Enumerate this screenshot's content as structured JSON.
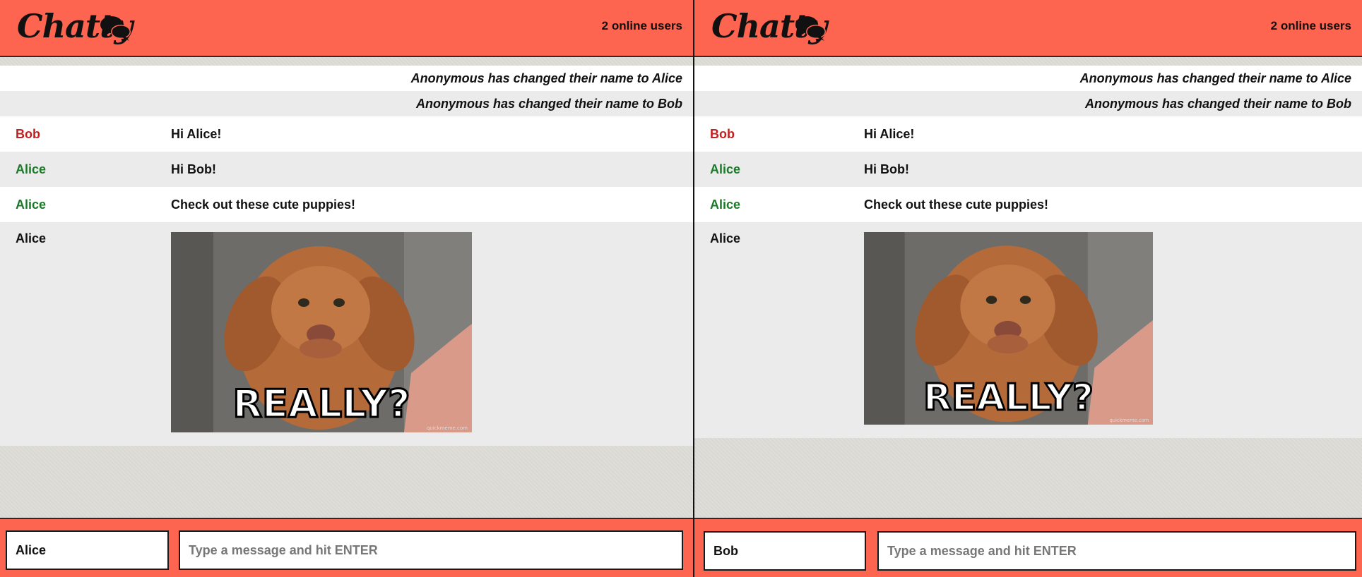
{
  "app": {
    "brand": "Chatty",
    "colors": {
      "navbar": "#fe6551",
      "bob_name": "#c22020",
      "alice_name": "#1a7a28",
      "system_name": "#111111"
    }
  },
  "panes": [
    {
      "online_users": "2 online users",
      "notifications": [
        "Anonymous has changed their name to Alice",
        "Anonymous has changed their name to Bob"
      ],
      "messages": [
        {
          "user": "Bob",
          "text": "Hi Alice!"
        },
        {
          "user": "Alice",
          "text": "Hi Bob!"
        },
        {
          "user": "Alice",
          "text": "Check out these cute puppies!"
        }
      ],
      "image_message": {
        "user": "Alice",
        "image_caption": "REALLY?",
        "image_watermark": "quickmeme.com"
      },
      "footer": {
        "username_value": "Alice",
        "message_placeholder": "Type a message and hit ENTER"
      }
    },
    {
      "online_users": "2 online users",
      "notifications": [
        "Anonymous has changed their name to Alice",
        "Anonymous has changed their name to Bob"
      ],
      "messages": [
        {
          "user": "Bob",
          "text": "Hi Alice!"
        },
        {
          "user": "Alice",
          "text": "Hi Bob!"
        },
        {
          "user": "Alice",
          "text": "Check out these cute puppies!"
        }
      ],
      "image_message": {
        "user": "Alice",
        "image_caption": "REALLY?",
        "image_watermark": "quickmeme.com"
      },
      "footer": {
        "username_value": "Bob",
        "message_placeholder": "Type a message and hit ENTER"
      }
    }
  ]
}
